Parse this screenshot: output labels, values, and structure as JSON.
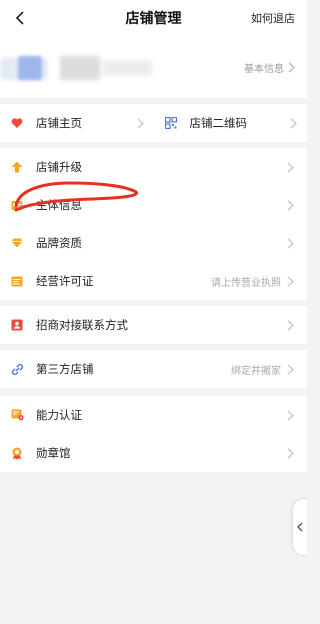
{
  "header": {
    "title": "店铺管理",
    "right_link": "如何退店"
  },
  "profile": {
    "right_label": "基本信息"
  },
  "quick_links": [
    {
      "label": "店铺主页"
    },
    {
      "label": "店铺二维码"
    }
  ],
  "menu": {
    "shop_upgrade": {
      "label": "店铺升级"
    },
    "entity_info": {
      "label": "主体信息"
    },
    "brand_qualification": {
      "label": "品牌资质"
    },
    "business_license": {
      "label": "经营许可证",
      "hint": "请上传营业执照"
    },
    "merchant_contact": {
      "label": "招商对接联系方式"
    },
    "third_party_shop": {
      "label": "第三方店铺",
      "hint": "绑定并搬家"
    },
    "capability_cert": {
      "label": "能力认证"
    },
    "badge_hall": {
      "label": "勋章馆"
    }
  },
  "colors": {
    "accent_orange": "#f5a623",
    "heart_red": "#f0483e",
    "blue": "#4a78e0",
    "annotation_red": "#e8301f"
  }
}
